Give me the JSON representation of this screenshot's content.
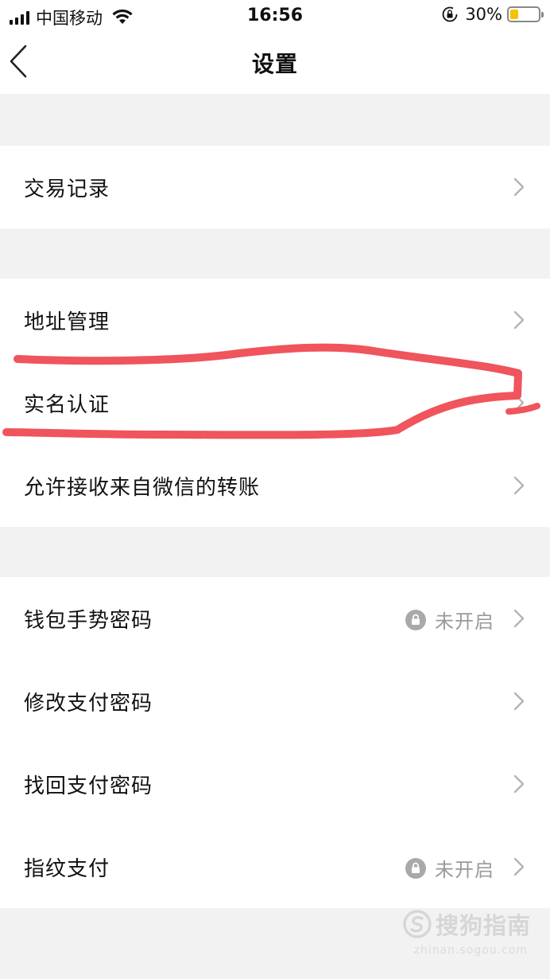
{
  "status_bar": {
    "carrier": "中国移动",
    "time": "16:56",
    "battery_percent": "30%",
    "battery_level": 0.3,
    "battery_color": "#f5c400"
  },
  "nav": {
    "title": "设置",
    "back_icon": "chevron-left-icon"
  },
  "groups": [
    {
      "items": [
        {
          "label": "交易记录"
        }
      ]
    },
    {
      "items": [
        {
          "label": "地址管理"
        },
        {
          "label": "实名认证"
        },
        {
          "label": "允许接收来自微信的转账"
        }
      ]
    },
    {
      "items": [
        {
          "label": "钱包手势密码",
          "status": "未开启",
          "status_icon": "lock-icon"
        },
        {
          "label": "修改支付密码"
        },
        {
          "label": "找回支付密码"
        },
        {
          "label": "指纹支付",
          "status": "未开启",
          "status_icon": "lock-icon"
        }
      ]
    }
  ],
  "annotation": {
    "color": "#f0545c",
    "target": "实名认证"
  },
  "watermark": {
    "text": "搜狗指南",
    "sub": "zhinan.sogou.com"
  }
}
